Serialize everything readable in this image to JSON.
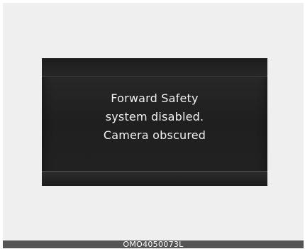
{
  "display": {
    "message_lines": [
      "Forward Safety",
      "system disabled.",
      "Camera obscured"
    ]
  },
  "caption": {
    "code": "OMO4050073L"
  }
}
